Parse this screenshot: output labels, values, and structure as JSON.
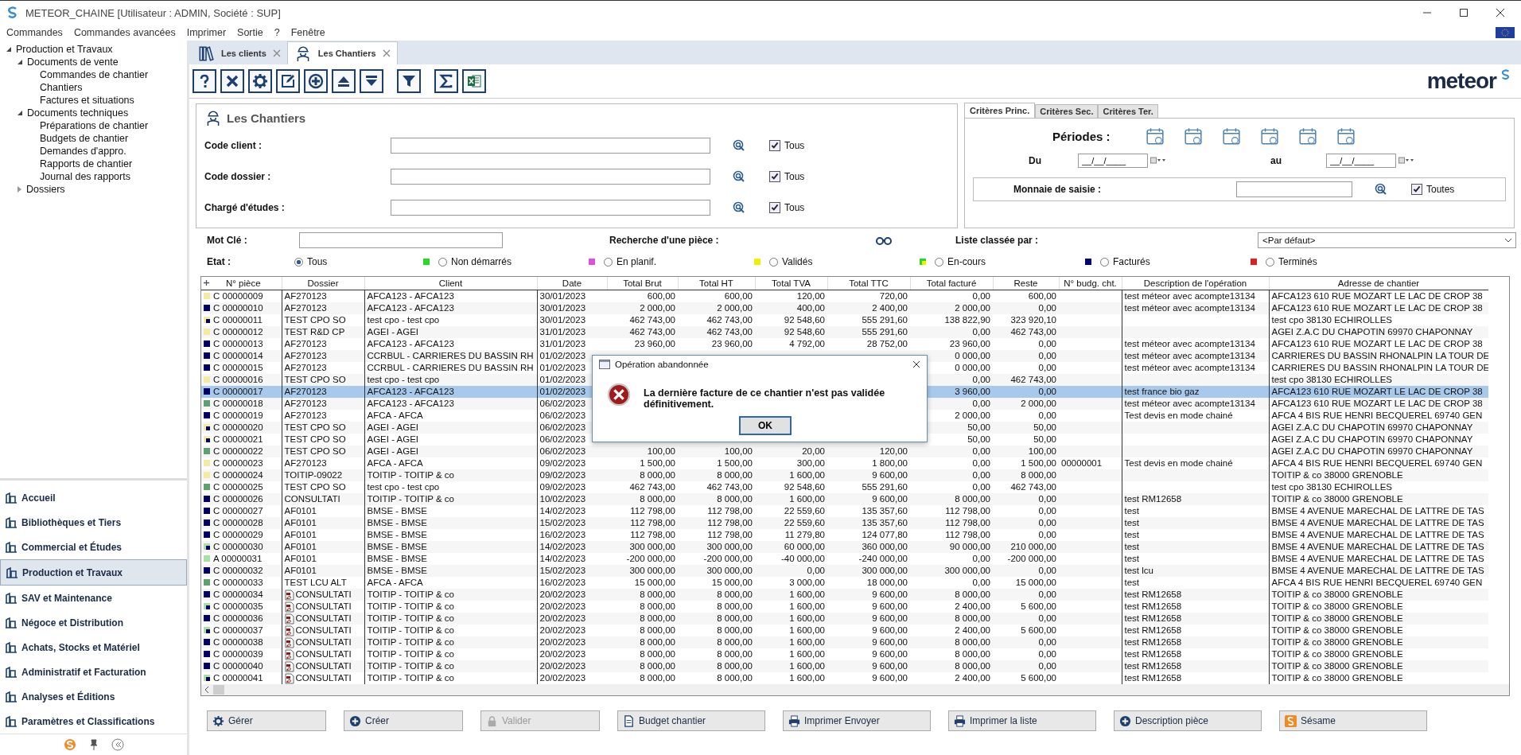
{
  "window": {
    "title": "METEOR_CHAINE [Utilisateur : ADMIN, Société : SUP]"
  },
  "menu": [
    "Commandes",
    "Commandes avancées",
    "Imprimer",
    "Sortie",
    "?",
    "Fenêtre"
  ],
  "tree": [
    {
      "label": "Production et Travaux",
      "expanded": true,
      "children": [
        {
          "label": "Documents de vente",
          "expanded": true,
          "children": [
            {
              "label": "Commandes de chantier"
            },
            {
              "label": "Chantiers"
            },
            {
              "label": "Factures et situations"
            }
          ]
        },
        {
          "label": "Documents techniques",
          "expanded": true,
          "children": [
            {
              "label": "Préparations de chantier"
            },
            {
              "label": "Budgets de chantier"
            },
            {
              "label": "Demandes d'appro."
            },
            {
              "label": "Rapports de chantier"
            },
            {
              "label": "Journal des rapports"
            }
          ]
        },
        {
          "label": "Dossiers",
          "expanded": false
        }
      ]
    }
  ],
  "modules": [
    {
      "label": "Accueil",
      "selected": false
    },
    {
      "label": "Bibliothèques et Tiers",
      "selected": false
    },
    {
      "label": "Commercial et Études",
      "selected": false
    },
    {
      "label": "Production et Travaux",
      "selected": true
    },
    {
      "label": "SAV et Maintenance",
      "selected": false
    },
    {
      "label": "Négoce et Distribution",
      "selected": false
    },
    {
      "label": "Achats, Stocks et Matériel",
      "selected": false
    },
    {
      "label": "Administratif et Facturation",
      "selected": false
    },
    {
      "label": "Analyses et Éditions",
      "selected": false
    },
    {
      "label": "Paramètres et Classifications",
      "selected": false
    }
  ],
  "tabs": [
    {
      "label": "Les clients",
      "selected": false
    },
    {
      "label": "Les Chantiers",
      "selected": true
    }
  ],
  "logo": "meteor",
  "form": {
    "title": "Les Chantiers",
    "fields": [
      {
        "label": "Code client :",
        "check_label": "Tous",
        "checked": true
      },
      {
        "label": "Code dossier :",
        "check_label": "Tous",
        "checked": true
      },
      {
        "label": "Chargé d'études :",
        "check_label": "Tous",
        "checked": true
      }
    ]
  },
  "criteria": {
    "tabs": [
      {
        "label": "Critères Princ.",
        "selected": true
      },
      {
        "label": "Critères Sec.",
        "selected": false
      },
      {
        "label": "Critères Ter.",
        "selected": false
      }
    ],
    "periods_label": "Périodes :",
    "from_label": "Du",
    "from_value": "__/__/____",
    "to_label": "au",
    "to_value": "__/__/____",
    "currency_label": "Monnaie de saisie :",
    "currency_check_label": "Toutes",
    "currency_checked": true
  },
  "keyword_label": "Mot Clé :",
  "piece_search_label": "Recherche d'une pièce :",
  "sort_label": "Liste classée par :",
  "sort_value": "<Par défaut>",
  "state_label": "Etat :",
  "states": [
    {
      "label": "Tous",
      "selected": true
    },
    {
      "label": "Non démarrés",
      "selected": false,
      "color": "#22dd22"
    },
    {
      "label": "En planif.",
      "selected": false,
      "color": "#e050e0"
    },
    {
      "label": "Validés",
      "selected": false,
      "color": "#f0f000"
    },
    {
      "label": "En-cours",
      "selected": false,
      "color": "#22dd22",
      "corner": {
        "color": "#f0f000"
      }
    },
    {
      "label": "Facturés",
      "selected": false,
      "color": "#000070"
    },
    {
      "label": "Terminés",
      "selected": false,
      "color": "#dd2020"
    }
  ],
  "table": {
    "columns": [
      "N° pièce",
      "Dossier",
      "Client",
      "Date",
      "Total Brut",
      "Total HT",
      "Total TVA",
      "Total TTC",
      "Total facturé",
      "Reste",
      "N° budg. cht.",
      "Description de l'opération",
      "Adresse de chantier"
    ],
    "rows": [
      {
        "selected": false,
        "color": "#f3eca0",
        "attachment": false,
        "cells": {
          "number": "C 00000009",
          "dossier": "AF270123",
          "client": "AFCA123 - AFCA123",
          "date": "30/01/2023",
          "brut": "600,00",
          "ht": "600,00",
          "tva": "120,00",
          "ttc": "720,00",
          "facture": "0,00",
          "reste": "600,00",
          "description": "test méteor avec acompte13134",
          "address": "AFCA123 610 RUE MOZART LE LAC DE CROP 38"
        }
      },
      {
        "selected": false,
        "color": "#000066",
        "attachment": false,
        "cells": {
          "number": "C 00000010",
          "dossier": "AF270123",
          "client": "AFCA123 - AFCA123",
          "date": "30/01/2023",
          "brut": "2 000,00",
          "ht": "2 000,00",
          "tva": "400,00",
          "ttc": "2 400,00",
          "facture": "2 000,00",
          "reste": "0,00",
          "description": "test méteor avec acompte13134",
          "address": "AFCA123 610 RUE MOZART LE LAC DE CROP 38"
        }
      },
      {
        "selected": false,
        "color": "#f3eca0",
        "corner": {
          "color": "#000066"
        },
        "attachment": false,
        "cells": {
          "number": "C 00000011",
          "dossier": "TEST CPO SO",
          "client": "test cpo - test cpo",
          "date": "30/01/2023",
          "brut": "462 743,00",
          "ht": "462 743,00",
          "tva": "92 548,60",
          "ttc": "555 291,60",
          "facture": "138 822,90",
          "reste": "323 920,10",
          "address": "test cpo   38130 ECHIROLLES"
        }
      },
      {
        "selected": false,
        "color": "#f3eca0",
        "attachment": false,
        "cells": {
          "number": "C 00000012",
          "dossier": "TEST R&D CP",
          "client": "AGEI - AGEI",
          "date": "31/01/2023",
          "brut": "462 743,00",
          "ht": "462 743,00",
          "tva": "92 548,60",
          "ttc": "555 291,60",
          "facture": "0,00",
          "reste": "462 743,00",
          "address": "AGEI Z.A.C DU CHAPOTIN  69970 CHAPONNAY"
        }
      },
      {
        "selected": false,
        "color": "#000066",
        "attachment": false,
        "cells": {
          "number": "C 00000013",
          "dossier": "AF270123",
          "client": "AFCA123 - AFCA123",
          "date": "31/01/2023",
          "brut": "23 960,00",
          "ht": "23 960,00",
          "tva": "4 792,00",
          "ttc": "28 752,00",
          "facture": "23 960,00",
          "reste": "0,00",
          "description": "test méteor avec acompte13134",
          "address": "AFCA123 610 RUE MOZART LE LAC DE CROP 38"
        }
      },
      {
        "selected": false,
        "color": "#000066",
        "attachment": false,
        "cells": {
          "number": "C 00000014",
          "dossier": "AF270123",
          "client": "CCRBUL - CARRIERES DU BASSIN RH",
          "date": "01/02/2023",
          "facture": "0 000,00",
          "reste": "0,00",
          "description": "test méteor avec acompte13134",
          "address": "CARRIERES DU BASSIN RHONALPIN LA TOUR DE"
        }
      },
      {
        "selected": false,
        "color": "#000066",
        "attachment": false,
        "cells": {
          "number": "C 00000015",
          "dossier": "AF270123",
          "client": "CCRBUL - CARRIERES DU BASSIN RH",
          "date": "01/02/2023",
          "facture": "0 000,00",
          "reste": "0,00",
          "description": "test méteor avec acompte13134",
          "address": "CARRIERES DU BASSIN RHONALPIN LA TOUR DE"
        }
      },
      {
        "selected": false,
        "color": "#f3eca0",
        "attachment": false,
        "cells": {
          "number": "C 00000016",
          "dossier": "TEST CPO SO",
          "client": "test cpo - test cpo",
          "date": "01/02/2023",
          "facture": "0,00",
          "reste": "462 743,00",
          "address": "test cpo   38130 ECHIROLLES"
        }
      },
      {
        "selected": true,
        "color": "#000066",
        "attachment": false,
        "cells": {
          "number": "C 00000017",
          "dossier": "AF270123",
          "client": "AFCA123 - AFCA123",
          "date": "01/02/2023",
          "facture": "3 960,00",
          "reste": "0,00",
          "description": "test france bio gaz",
          "address": "AFCA123 610 RUE MOZART LE LAC DE CROP 38"
        }
      },
      {
        "selected": false,
        "color": "#5fa070",
        "attachment": false,
        "cells": {
          "number": "C 00000018",
          "dossier": "AF270123",
          "client": "AFCA123 - AFCA123",
          "date": "06/02/2023",
          "facture": "0,00",
          "reste": "2 000,00",
          "description": "test méteor avec acompte13134",
          "address": "AFCA123 610 RUE MOZART LE LAC DE CROP 38"
        }
      },
      {
        "selected": false,
        "color": "#000066",
        "attachment": false,
        "cells": {
          "number": "C 00000019",
          "dossier": "AF270123",
          "client": "AFCA - AFCA",
          "date": "06/02/2023",
          "facture": "2 000,00",
          "reste": "0,00",
          "description": "Test devis en mode chainé",
          "address": "AFCA 4 BIS RUE HENRI BECQUEREL  69740 GEN"
        }
      },
      {
        "selected": false,
        "color": "#f3eca0",
        "corner": {
          "color": "#000066"
        },
        "attachment": false,
        "cells": {
          "number": "C 00000020",
          "dossier": "TEST CPO SO",
          "client": "AGEI - AGEI",
          "date": "06/02/2023",
          "facture": "50,00",
          "reste": "50,00",
          "address": "AGEI Z.A.C DU CHAPOTIN  69970 CHAPONNAY"
        }
      },
      {
        "selected": false,
        "color": "#f3eca0",
        "corner": {
          "color": "#000066"
        },
        "attachment": false,
        "cells": {
          "number": "C 00000021",
          "dossier": "TEST CPO SO",
          "client": "AGEI - AGEI",
          "date": "06/02/2023",
          "facture": "50,00",
          "reste": "50,00",
          "address": "AGEI Z.A.C DU CHAPOTIN  69970 CHAPONNAY"
        }
      },
      {
        "selected": false,
        "color": "#5fa070",
        "attachment": false,
        "cells": {
          "number": "C 00000022",
          "dossier": "TEST CPO SO",
          "client": "AGEI - AGEI",
          "date": "06/02/2023",
          "brut": "100,00",
          "ht": "100,00",
          "tva": "20,00",
          "ttc": "120,00",
          "facture": "0,00",
          "reste": "100,00",
          "address": "AGEI Z.A.C DU CHAPOTIN  69970 CHAPONNAY"
        }
      },
      {
        "selected": false,
        "color": "#f3eca0",
        "attachment": false,
        "cells": {
          "number": "C 00000023",
          "dossier": "AF270123",
          "client": "AFCA - AFCA",
          "date": "09/02/2023",
          "brut": "1 500,00",
          "ht": "1 500,00",
          "tva": "300,00",
          "ttc": "1 800,00",
          "facture": "0,00",
          "reste": "1 500,00",
          "budget": "00000001",
          "description": "Test devis en mode chainé",
          "address": "AFCA 4 BIS RUE HENRI BECQUEREL  69740 GEN"
        }
      },
      {
        "selected": false,
        "color": "#f3eca0",
        "attachment": false,
        "cells": {
          "number": "C 00000024",
          "dossier": "TOITIP-09022",
          "client": "TOITIP - TOITIP & co",
          "date": "09/02/2023",
          "brut": "8 000,00",
          "ht": "8 000,00",
          "tva": "1 600,00",
          "ttc": "9 600,00",
          "facture": "0,00",
          "reste": "8 000,00",
          "address": "TOITIP & co   38000 GRENOBLE"
        }
      },
      {
        "selected": false,
        "color": "#5fa070",
        "attachment": false,
        "cells": {
          "number": "C 00000025",
          "dossier": "TEST CPO SO",
          "client": "test cpo - test cpo",
          "date": "09/02/2023",
          "brut": "462 743,00",
          "ht": "462 743,00",
          "tva": "92 548,60",
          "ttc": "555 291,60",
          "facture": "0,00",
          "reste": "462 743,00",
          "address": "test cpo   38130 ECHIROLLES"
        }
      },
      {
        "selected": false,
        "color": "#000066",
        "attachment": false,
        "cells": {
          "number": "C 00000026",
          "dossier": "CONSULTATI",
          "client": "TOITIP - TOITIP & co",
          "date": "10/02/2023",
          "brut": "8 000,00",
          "ht": "8 000,00",
          "tva": "1 600,00",
          "ttc": "9 600,00",
          "facture": "8 000,00",
          "reste": "0,00",
          "description": "test RM12658",
          "address": "TOITIP & co   38000 GRENOBLE"
        }
      },
      {
        "selected": false,
        "color": "#000066",
        "attachment": false,
        "cells": {
          "number": "C 00000027",
          "dossier": "AF0101",
          "client": "BMSE - BMSE",
          "date": "14/02/2023",
          "brut": "112 798,00",
          "ht": "112 798,00",
          "tva": "22 559,60",
          "ttc": "135 357,60",
          "facture": "112 798,00",
          "reste": "0,00",
          "description": "test",
          "address": "BMSE 4 AVENUE MARECHAL DE LATTRE DE TAS"
        }
      },
      {
        "selected": false,
        "color": "#000066",
        "attachment": false,
        "cells": {
          "number": "C 00000028",
          "dossier": "AF0101",
          "client": "BMSE - BMSE",
          "date": "15/02/2023",
          "brut": "112 798,00",
          "ht": "112 798,00",
          "tva": "22 559,60",
          "ttc": "135 357,60",
          "facture": "112 798,00",
          "reste": "0,00",
          "description": "test",
          "address": "BMSE 4 AVENUE MARECHAL DE LATTRE DE TAS"
        }
      },
      {
        "selected": false,
        "color": "#000066",
        "attachment": false,
        "cells": {
          "number": "C 00000029",
          "dossier": "AF0101",
          "client": "BMSE - BMSE",
          "date": "16/02/2023",
          "brut": "112 798,00",
          "ht": "112 798,00",
          "tva": "11 279,80",
          "ttc": "124 077,80",
          "facture": "112 798,00",
          "reste": "0,00",
          "description": "test",
          "address": "BMSE 4 AVENUE MARECHAL DE LATTRE DE TAS"
        }
      },
      {
        "selected": false,
        "color": "#a8e0a8",
        "corner": {
          "color": "#000066"
        },
        "attachment": false,
        "cells": {
          "number": "C 00000030",
          "dossier": "AF0101",
          "client": "BMSE - BMSE",
          "date": "14/02/2023",
          "brut": "300 000,00",
          "ht": "300 000,00",
          "tva": "60 000,00",
          "ttc": "360 000,00",
          "facture": "90 000,00",
          "reste": "210 000,00",
          "description": "test",
          "address": "BMSE 4 AVENUE MARECHAL DE LATTRE DE TAS"
        }
      },
      {
        "selected": false,
        "color": "#a8e0a8",
        "attachment": false,
        "cells": {
          "number": "A 00000031",
          "dossier": "AF0101",
          "client": "BMSE - BMSE",
          "date": "14/02/2023",
          "brut": "-200 000,00",
          "ht": "-200 000,00",
          "tva": "-40 000,00",
          "ttc": "-240 000,00",
          "facture": "0,00",
          "reste": "-200 000,00",
          "description": "test",
          "address": "BMSE 4 AVENUE MARECHAL DE LATTRE DE TAS"
        }
      },
      {
        "selected": false,
        "color": "#000066",
        "attachment": false,
        "cells": {
          "number": "C 00000032",
          "dossier": "AF0101",
          "client": "BMSE - BMSE",
          "date": "15/02/2023",
          "brut": "300 000,00",
          "ht": "300 000,00",
          "tva": "0,00",
          "ttc": "300 000,00",
          "facture": "300 000,00",
          "reste": "0,00",
          "description": "test lcu",
          "address": "BMSE 4 AVENUE MARECHAL DE LATTRE DE TAS"
        }
      },
      {
        "selected": false,
        "color": "#5fa070",
        "attachment": false,
        "cells": {
          "number": "C 00000033",
          "dossier": "TEST LCU ALT",
          "client": "AFCA - AFCA",
          "date": "16/02/2023",
          "brut": "15 000,00",
          "ht": "15 000,00",
          "tva": "3 000,00",
          "ttc": "18 000,00",
          "facture": "0,00",
          "reste": "15 000,00",
          "description": "test",
          "address": "AFCA 4 BIS RUE HENRI BECQUEREL  69740 GEN"
        }
      },
      {
        "selected": false,
        "color": "#000066",
        "attachment": true,
        "cells": {
          "number": "C 00000034",
          "dossier": "CONSULTATI",
          "client": "TOITIP - TOITIP & co",
          "date": "20/02/2023",
          "brut": "8 000,00",
          "ht": "8 000,00",
          "tva": "1 600,00",
          "ttc": "9 600,00",
          "facture": "8 000,00",
          "reste": "0,00",
          "description": "test RM12658",
          "address": "TOITIP & co   38000 GRENOBLE"
        }
      },
      {
        "selected": false,
        "color": "#a8e0a8",
        "corner": {
          "color": "#000066"
        },
        "attachment": true,
        "cells": {
          "number": "C 00000035",
          "dossier": "CONSULTATI",
          "client": "TOITIP - TOITIP & co",
          "date": "20/02/2023",
          "brut": "8 000,00",
          "ht": "8 000,00",
          "tva": "1 600,00",
          "ttc": "9 600,00",
          "facture": "2 400,00",
          "reste": "5 600,00",
          "description": "test RM12658",
          "address": "TOITIP & co   38000 GRENOBLE"
        }
      },
      {
        "selected": false,
        "color": "#000066",
        "attachment": true,
        "cells": {
          "number": "C 00000036",
          "dossier": "CONSULTATI",
          "client": "TOITIP - TOITIP & co",
          "date": "20/02/2023",
          "brut": "8 000,00",
          "ht": "8 000,00",
          "tva": "1 600,00",
          "ttc": "9 600,00",
          "facture": "8 000,00",
          "reste": "0,00",
          "description": "test RM12658",
          "address": "TOITIP & co   38000 GRENOBLE"
        }
      },
      {
        "selected": false,
        "color": "#a8e0a8",
        "corner": {
          "color": "#000066"
        },
        "attachment": true,
        "cells": {
          "number": "C 00000037",
          "dossier": "CONSULTATI",
          "client": "TOITIP - TOITIP & co",
          "date": "20/02/2023",
          "brut": "8 000,00",
          "ht": "8 000,00",
          "tva": "1 600,00",
          "ttc": "9 600,00",
          "facture": "2 400,00",
          "reste": "5 600,00",
          "description": "test RM12658",
          "address": "TOITIP & co   38000 GRENOBLE"
        }
      },
      {
        "selected": false,
        "color": "#000066",
        "attachment": true,
        "cells": {
          "number": "C 00000038",
          "dossier": "CONSULTATI",
          "client": "TOITIP - TOITIP & co",
          "date": "20/02/2023",
          "brut": "8 000,00",
          "ht": "8 000,00",
          "tva": "1 600,00",
          "ttc": "9 600,00",
          "facture": "8 000,00",
          "reste": "0,00",
          "description": "test RM12658",
          "address": "TOITIP & co   38000 GRENOBLE"
        }
      },
      {
        "selected": false,
        "color": "#000066",
        "attachment": true,
        "cells": {
          "number": "C 00000039",
          "dossier": "CONSULTATI",
          "client": "TOITIP - TOITIP & co",
          "date": "20/02/2023",
          "brut": "8 000,00",
          "ht": "8 000,00",
          "tva": "1 600,00",
          "ttc": "9 600,00",
          "facture": "8 000,00",
          "reste": "0,00",
          "description": "test RM12658",
          "address": "TOITIP & co   38000 GRENOBLE"
        }
      },
      {
        "selected": false,
        "color": "#000066",
        "attachment": true,
        "cells": {
          "number": "C 00000040",
          "dossier": "CONSULTATI",
          "client": "TOITIP - TOITIP & co",
          "date": "20/02/2023",
          "brut": "8 000,00",
          "ht": "8 000,00",
          "tva": "1 600,00",
          "ttc": "9 600,00",
          "facture": "8 000,00",
          "reste": "0,00",
          "description": "test RM12658",
          "address": "TOITIP & co   38000 GRENOBLE"
        }
      },
      {
        "selected": false,
        "color": "#a8e0a8",
        "corner": {
          "color": "#000066"
        },
        "attachment": true,
        "cells": {
          "number": "C 00000041",
          "dossier": "CONSULTATI",
          "client": "TOITIP - TOITIP & co",
          "date": "20/02/2023",
          "brut": "8 000,00",
          "ht": "8 000,00",
          "tva": "1 600,00",
          "ttc": "9 600,00",
          "facture": "2 400,00",
          "reste": "5 600,00",
          "description": "test RM12658",
          "address": "TOITIP & co   38000 GRENOBLE"
        }
      }
    ]
  },
  "actions": [
    {
      "label": "Gérer",
      "kind": "gear",
      "disabled": false
    },
    {
      "label": "Créer",
      "kind": "plus",
      "disabled": false
    },
    {
      "label": "Valider",
      "kind": "lock",
      "disabled": true
    },
    {
      "label": "Budget chantier",
      "kind": "doc",
      "disabled": false
    },
    {
      "label": "Imprimer Envoyer",
      "kind": "print",
      "disabled": false
    },
    {
      "label": "Imprimer la liste",
      "kind": "print",
      "disabled": false
    },
    {
      "label": "Description pièce",
      "kind": "plus",
      "disabled": false
    },
    {
      "label": "Sésame",
      "kind": "logo",
      "disabled": false
    }
  ],
  "dialog": {
    "title": "Opération abandonnée",
    "message": "La dernière facture de ce chantier n'est pas validée définitivement.",
    "button": "OK"
  }
}
